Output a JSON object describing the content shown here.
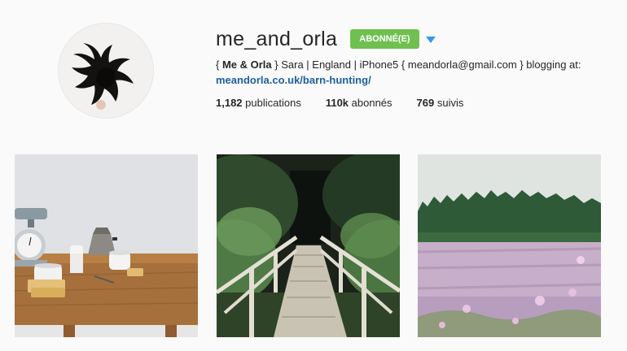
{
  "profile": {
    "username": "me_and_orla",
    "follow_label": "ABONNÉ(E)",
    "bio": {
      "open_brace": "{ ",
      "name": "Me & Orla",
      "rest": " } Sara | England | iPhone5 { meandorla@gmail.com } blogging at:",
      "link": "meandorla.co.uk/barn-hunting/"
    },
    "stats": [
      {
        "value": "1,182",
        "label": " publications"
      },
      {
        "value": "110k",
        "label": " abonnés"
      },
      {
        "value": "769",
        "label": " suivis"
      }
    ]
  },
  "posts": [
    {
      "subject": "kitchen table with scale, milk and coffee pot"
    },
    {
      "subject": "wooden footbridge into a forest"
    },
    {
      "subject": "heather field in front of a pine forest"
    }
  ],
  "colors": {
    "follow_button": "#70c050",
    "link": "#1e5f9e",
    "dropdown_arrow": "#3897f0"
  },
  "icons": {
    "dropdown": "triangle-down-icon"
  }
}
